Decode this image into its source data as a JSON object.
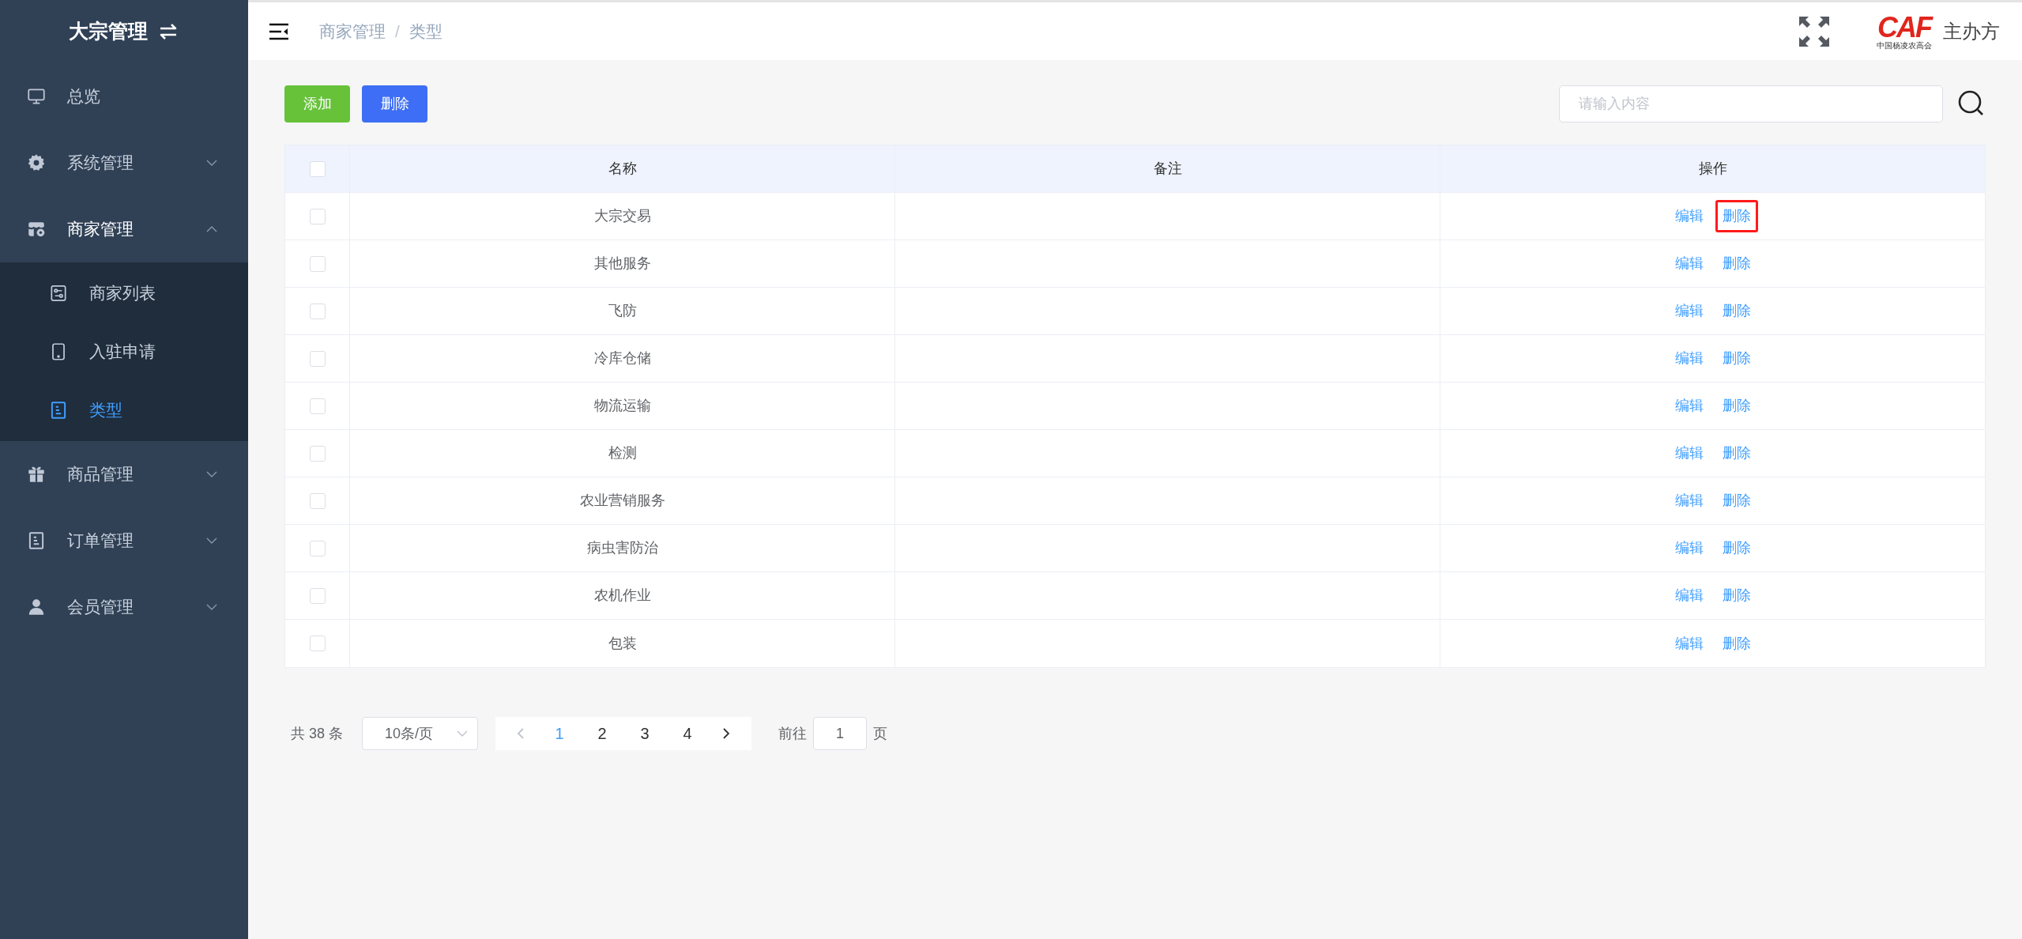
{
  "sidebar": {
    "title": "大宗管理",
    "items": [
      {
        "label": "总览",
        "kind": "monitor",
        "selected": false
      },
      {
        "label": "系统管理",
        "kind": "gear",
        "expanded": false,
        "selected": false
      },
      {
        "label": "商家管理",
        "kind": "store",
        "expanded": true,
        "selected": false,
        "children": [
          {
            "label": "商家列表",
            "kind": "list",
            "selected": false
          },
          {
            "label": "入驻申请",
            "kind": "tablet",
            "selected": false
          },
          {
            "label": "类型",
            "kind": "doc",
            "selected": true
          }
        ]
      },
      {
        "label": "商品管理",
        "kind": "gift",
        "expanded": false,
        "selected": false
      },
      {
        "label": "订单管理",
        "kind": "doc",
        "expanded": false,
        "selected": false
      },
      {
        "label": "会员管理",
        "kind": "user",
        "expanded": false,
        "selected": false
      }
    ]
  },
  "breadcrumb": {
    "items": [
      "商家管理",
      "类型"
    ],
    "separator": "/"
  },
  "header": {
    "logo": {
      "mark": "CAF",
      "caption": "中国杨凌农高会"
    },
    "organizer": "主办方"
  },
  "toolbar": {
    "buttons": [
      {
        "label": "添加",
        "kind": "success"
      },
      {
        "label": "删除",
        "kind": "primary"
      }
    ],
    "search": {
      "placeholder": "请输入内容"
    }
  },
  "table": {
    "columns": [
      "名称",
      "备注",
      "操作"
    ],
    "header_checked": false,
    "rows": [
      {
        "name": "大宗交易",
        "checked": false,
        "actions": [
          {
            "label": "编辑",
            "highlighted": false
          },
          {
            "label": "删除",
            "highlighted": true
          }
        ]
      },
      {
        "name": "其他服务",
        "checked": false,
        "actions": [
          {
            "label": "编辑",
            "highlighted": false
          },
          {
            "label": "删除",
            "highlighted": false
          }
        ]
      },
      {
        "name": "飞防",
        "checked": false,
        "actions": [
          {
            "label": "编辑",
            "highlighted": false
          },
          {
            "label": "删除",
            "highlighted": false
          }
        ]
      },
      {
        "name": "冷库仓储",
        "checked": false,
        "actions": [
          {
            "label": "编辑",
            "highlighted": false
          },
          {
            "label": "删除",
            "highlighted": false
          }
        ]
      },
      {
        "name": "物流运输",
        "checked": false,
        "actions": [
          {
            "label": "编辑",
            "highlighted": false
          },
          {
            "label": "删除",
            "highlighted": false
          }
        ]
      },
      {
        "name": "检测",
        "checked": false,
        "actions": [
          {
            "label": "编辑",
            "highlighted": false
          },
          {
            "label": "删除",
            "highlighted": false
          }
        ]
      },
      {
        "name": "农业营销服务",
        "checked": false,
        "actions": [
          {
            "label": "编辑",
            "highlighted": false
          },
          {
            "label": "删除",
            "highlighted": false
          }
        ]
      },
      {
        "name": "病虫害防治",
        "checked": false,
        "actions": [
          {
            "label": "编辑",
            "highlighted": false
          },
          {
            "label": "删除",
            "highlighted": false
          }
        ]
      },
      {
        "name": "农机作业",
        "checked": false,
        "actions": [
          {
            "label": "编辑",
            "highlighted": false
          },
          {
            "label": "删除",
            "highlighted": false
          }
        ]
      },
      {
        "name": "包装",
        "checked": false,
        "actions": [
          {
            "label": "编辑",
            "highlighted": false
          },
          {
            "label": "删除",
            "highlighted": false
          }
        ]
      }
    ]
  },
  "pagination": {
    "total": "共 38 条",
    "page_size": "10条/页",
    "pages": [
      {
        "label": "1",
        "selected": true
      },
      {
        "label": "2",
        "selected": false
      },
      {
        "label": "3",
        "selected": false
      },
      {
        "label": "4",
        "selected": false
      }
    ],
    "goto_label": "前往",
    "goto_value": "1",
    "goto_suffix": "页"
  }
}
